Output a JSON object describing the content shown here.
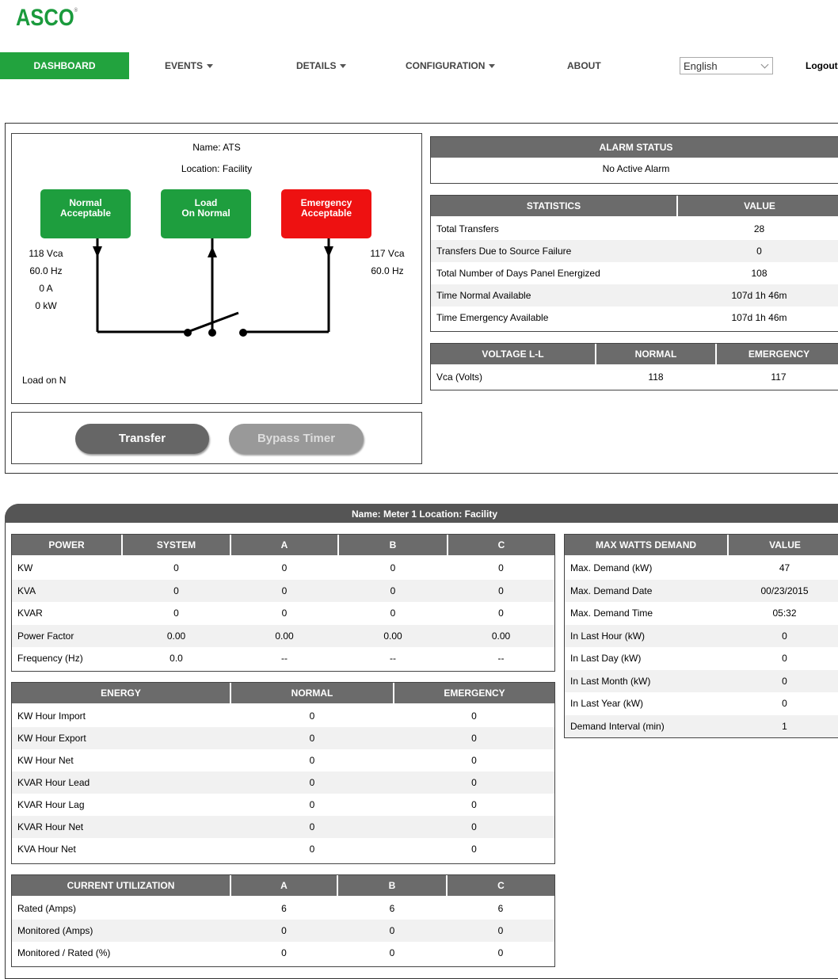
{
  "brand": {
    "logo": "ASCO",
    "mark": "®"
  },
  "nav": {
    "items": [
      {
        "label": "DASHBOARD",
        "active": true,
        "dropdown": false
      },
      {
        "label": "EVENTS",
        "dropdown": true
      },
      {
        "label": "DETAILS",
        "dropdown": true
      },
      {
        "label": "CONFIGURATION",
        "dropdown": true
      },
      {
        "label": "ABOUT",
        "dropdown": false
      }
    ],
    "language": "English",
    "logout": "Logout"
  },
  "ats": {
    "name": "Name: ATS",
    "location": "Location: Facility",
    "sources": {
      "normal": {
        "line1": "Normal",
        "line2": "Acceptable",
        "color": "#1e9e3e"
      },
      "load": {
        "line1": "Load",
        "line2": "On Normal",
        "color": "#1e9e3e"
      },
      "emergency": {
        "line1": "Emergency",
        "line2": "Acceptable",
        "color": "#ee1111"
      }
    },
    "normal_meas": {
      "voltage": "118 Vca",
      "freq": "60.0 Hz",
      "current": "0 A",
      "power": "0 kW"
    },
    "emergency_meas": {
      "voltage": "117 Vca",
      "freq": "60.0 Hz"
    },
    "load_status": "Load on N",
    "buttons": {
      "transfer": "Transfer",
      "bypass": "Bypass Timer"
    }
  },
  "alarm": {
    "title": "ALARM STATUS",
    "value": "No Active Alarm"
  },
  "statistics": {
    "headers": [
      "STATISTICS",
      "VALUE"
    ],
    "rows": [
      [
        "Total Transfers",
        "28"
      ],
      [
        "Transfers Due to Source Failure",
        "0"
      ],
      [
        "Total Number of Days Panel Energized",
        "108"
      ],
      [
        "Time Normal Available",
        "107d 1h 46m"
      ],
      [
        "Time Emergency Available",
        "107d 1h 46m"
      ]
    ]
  },
  "voltage": {
    "headers": [
      "VOLTAGE L-L",
      "NORMAL",
      "EMERGENCY"
    ],
    "rows": [
      [
        "Vca (Volts)",
        "118",
        "117"
      ]
    ]
  },
  "meter": {
    "title": "Name: Meter 1  Location: Facility",
    "power": {
      "headers": [
        "POWER",
        "SYSTEM",
        "A",
        "B",
        "C"
      ],
      "rows": [
        [
          "KW",
          "0",
          "0",
          "0",
          "0"
        ],
        [
          "KVA",
          "0",
          "0",
          "0",
          "0"
        ],
        [
          "KVAR",
          "0",
          "0",
          "0",
          "0"
        ],
        [
          "Power Factor",
          "0.00",
          "0.00",
          "0.00",
          "0.00"
        ],
        [
          "Frequency (Hz)",
          "0.0",
          "--",
          "--",
          "--"
        ]
      ]
    },
    "energy": {
      "headers": [
        "ENERGY",
        "NORMAL",
        "EMERGENCY"
      ],
      "rows": [
        [
          "KW Hour Import",
          "0",
          "0"
        ],
        [
          "KW Hour Export",
          "0",
          "0"
        ],
        [
          "KW Hour Net",
          "0",
          "0"
        ],
        [
          "KVAR Hour Lead",
          "0",
          "0"
        ],
        [
          "KVAR Hour Lag",
          "0",
          "0"
        ],
        [
          "KVAR Hour Net",
          "0",
          "0"
        ],
        [
          "KVA Hour Net",
          "0",
          "0"
        ]
      ]
    },
    "current": {
      "headers": [
        "CURRENT UTILIZATION",
        "A",
        "B",
        "C"
      ],
      "rows": [
        [
          "Rated (Amps)",
          "6",
          "6",
          "6"
        ],
        [
          "Monitored (Amps)",
          "0",
          "0",
          "0"
        ],
        [
          "Monitored / Rated (%)",
          "0",
          "0",
          "0"
        ]
      ]
    },
    "demand": {
      "headers": [
        "MAX WATTS DEMAND",
        "VALUE"
      ],
      "rows": [
        [
          "Max. Demand (kW)",
          "47"
        ],
        [
          "Max. Demand Date",
          "00/23/2015"
        ],
        [
          "Max. Demand Time",
          "05:32"
        ],
        [
          "In Last Hour (kW)",
          "0"
        ],
        [
          "In Last Day (kW)",
          "0"
        ],
        [
          "In Last Month (kW)",
          "0"
        ],
        [
          "In Last Year (kW)",
          "0"
        ],
        [
          "Demand Interval (min)",
          "1"
        ]
      ]
    }
  }
}
